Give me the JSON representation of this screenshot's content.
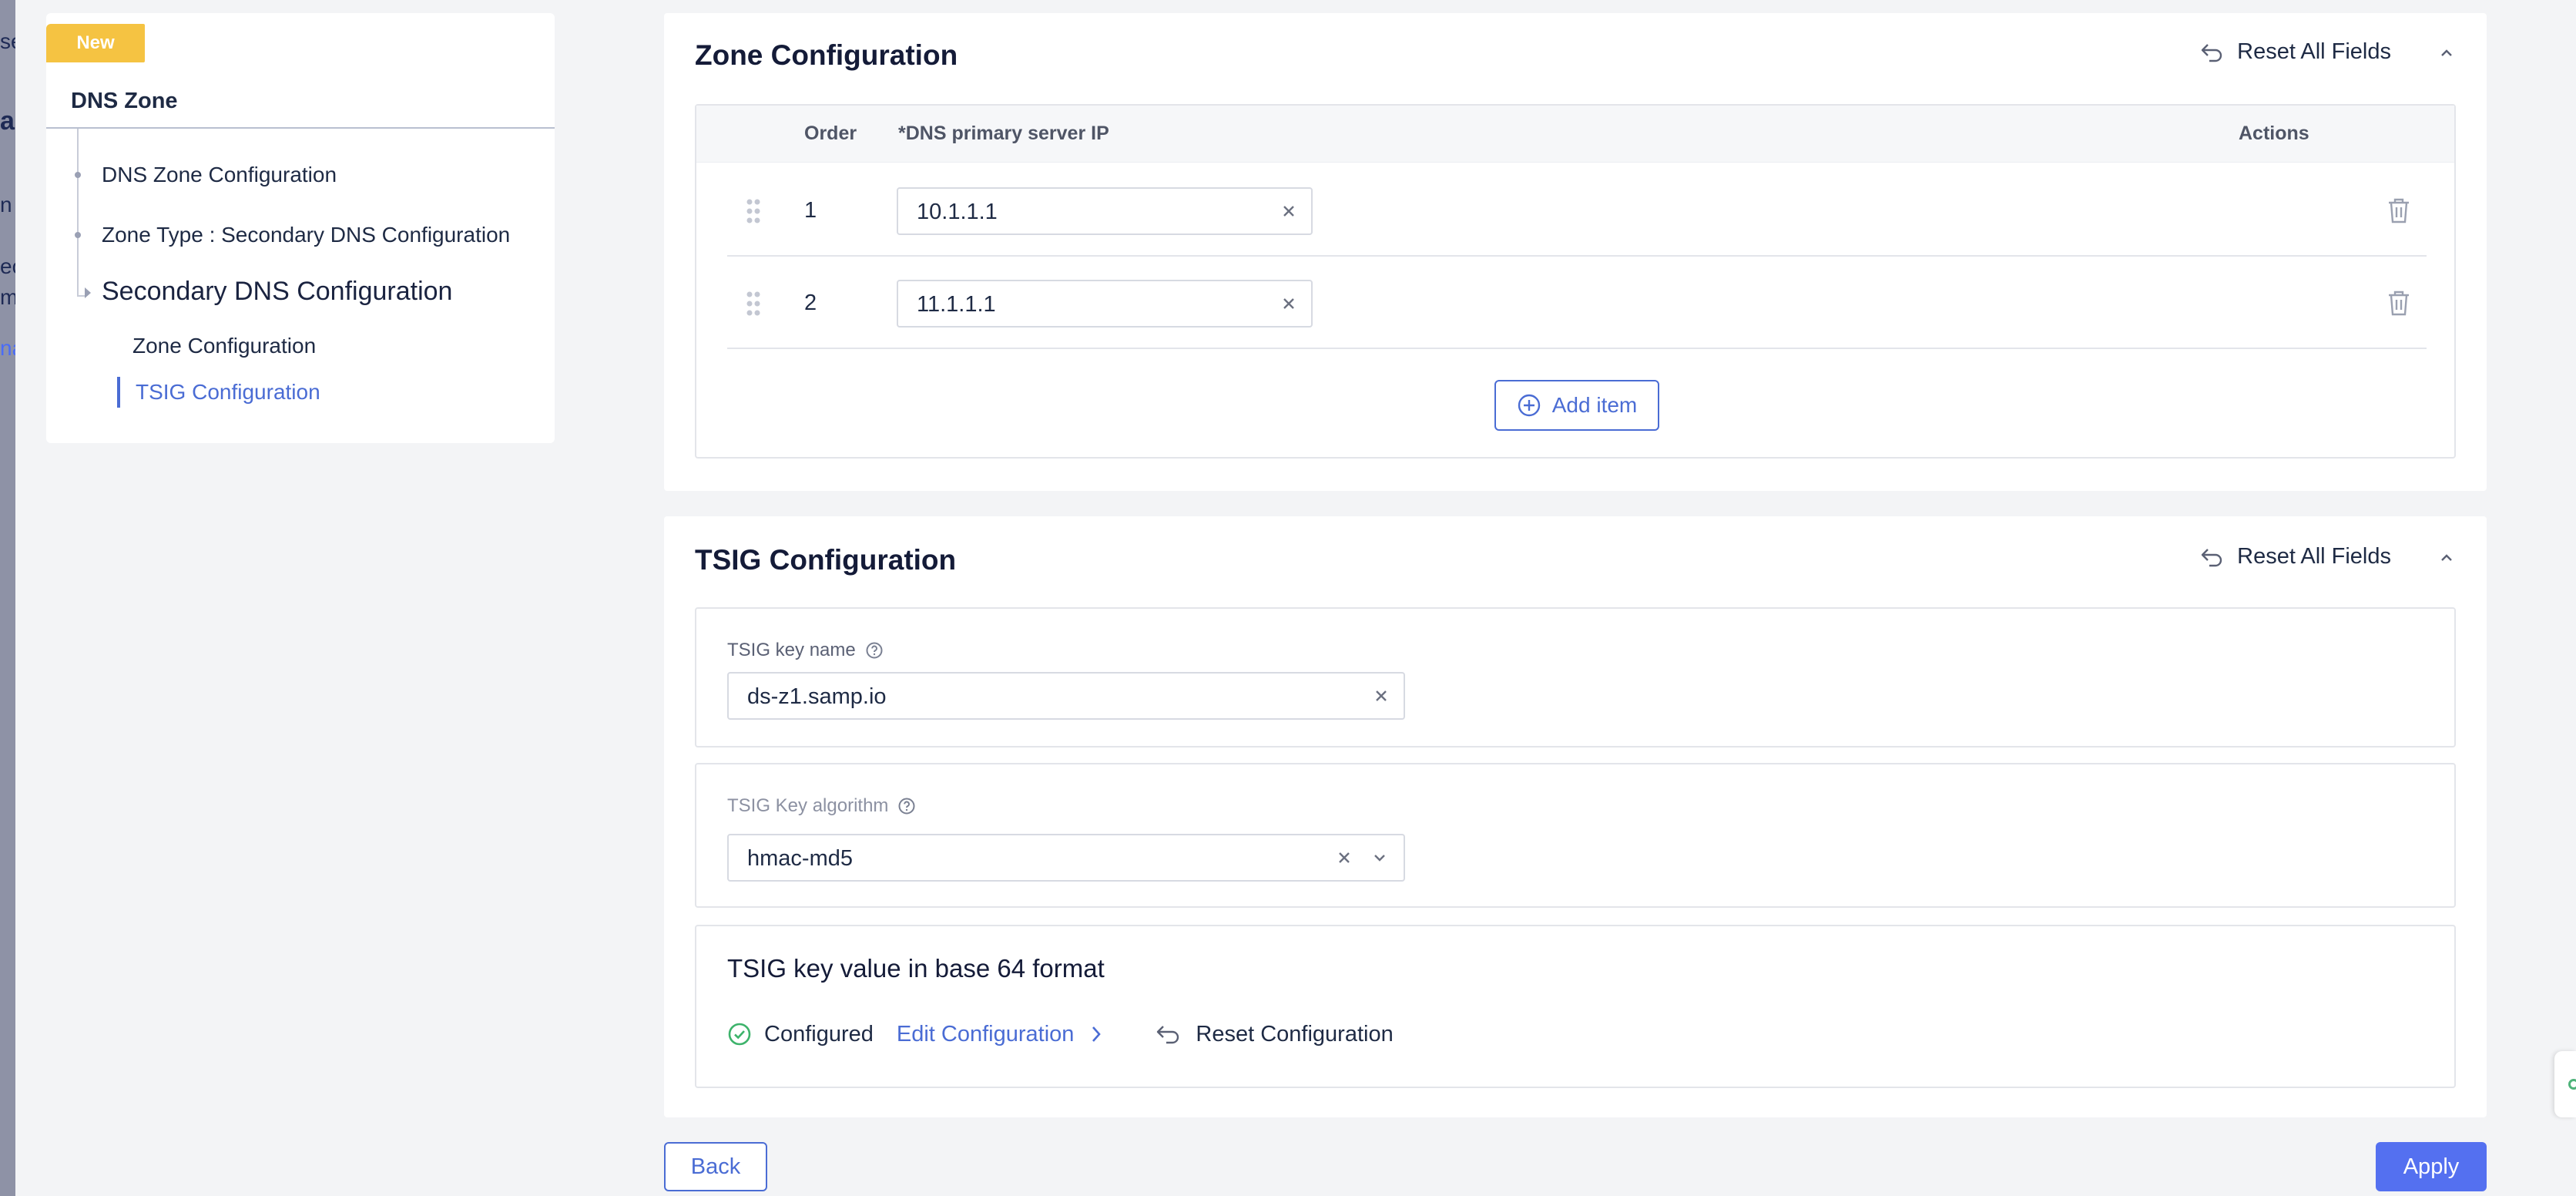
{
  "background_fragments": [
    "se",
    "ag",
    "n l",
    "ec",
    "m",
    "na"
  ],
  "nav": {
    "badge": "New",
    "title": "DNS Zone",
    "items": [
      {
        "label": "DNS Zone Configuration"
      },
      {
        "label": "Zone Type : Secondary DNS Configuration"
      },
      {
        "label": "Secondary DNS Configuration"
      },
      {
        "label": "Zone Configuration"
      },
      {
        "label": "TSIG Configuration",
        "active": true
      }
    ]
  },
  "zone_section": {
    "title": "Zone Configuration",
    "reset_label": "Reset All Fields",
    "columns": {
      "order": "Order",
      "ip": "*DNS primary server IP",
      "actions": "Actions"
    },
    "rows": [
      {
        "order": "1",
        "ip": "10.1.1.1"
      },
      {
        "order": "2",
        "ip": "11.1.1.1"
      }
    ],
    "add_label": "Add item"
  },
  "tsig_section": {
    "title": "TSIG Configuration",
    "reset_label": "Reset All Fields",
    "key_name": {
      "label": "TSIG key name",
      "value": "ds-z1.samp.io"
    },
    "key_algorithm": {
      "label": "TSIG Key algorithm",
      "value": "hmac-md5"
    },
    "key_value": {
      "heading": "TSIG key value in base 64 format",
      "status": "Configured",
      "edit_label": "Edit Configuration",
      "reset_label": "Reset Configuration"
    }
  },
  "footer": {
    "back_label": "Back",
    "apply_label": "Apply"
  },
  "colors": {
    "accent": "#4a6cd4",
    "primary_button": "#5470f0",
    "badge": "#f5c342",
    "success": "#3db36b"
  }
}
